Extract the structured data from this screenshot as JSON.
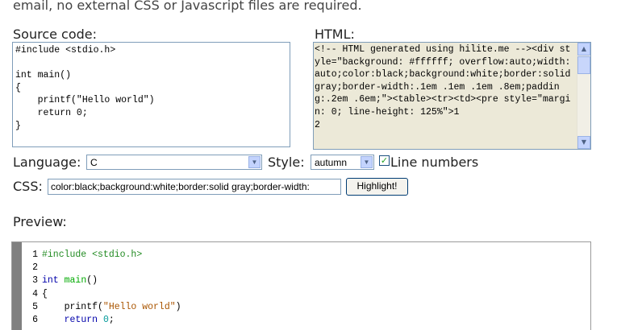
{
  "intro_text": "email, no external CSS or Javascript files are required.",
  "source": {
    "label": "Source code:",
    "code": "#include <stdio.h>\n\nint main()\n{\n    printf(\"Hello world\")\n    return 0;\n}"
  },
  "html_output": {
    "label": "HTML:",
    "text": "<!-- HTML generated using hilite.me --><div style=\"background: #ffffff; overflow:auto;width:auto;color:black;background:white;border:solid gray;border-width:.1em .1em .1em .8em;padding:.2em .6em;\"><table><tr><td><pre style=\"margin: 0; line-height: 125%\">1\n2"
  },
  "language": {
    "label": "Language:",
    "value": "C"
  },
  "style": {
    "label": "Style:",
    "value": "autumn"
  },
  "line_numbers": {
    "label": "Line numbers",
    "checked": true
  },
  "css": {
    "label": "CSS:",
    "value": "color:black;background:white;border:solid gray;border-width:"
  },
  "highlight_button": "Highlight!",
  "preview": {
    "label": "Preview:",
    "lines": [
      {
        "n": "1",
        "parts": [
          {
            "t": "#include <stdio.h>",
            "c": "pp"
          }
        ]
      },
      {
        "n": "2",
        "parts": []
      },
      {
        "n": "3",
        "parts": [
          {
            "t": "int",
            "c": "kw"
          },
          {
            "t": " "
          },
          {
            "t": "main",
            "c": "fn"
          },
          {
            "t": "()"
          }
        ]
      },
      {
        "n": "4",
        "parts": [
          {
            "t": "{"
          }
        ]
      },
      {
        "n": "5",
        "parts": [
          {
            "t": "    printf("
          },
          {
            "t": "\"Hello world\"",
            "c": "str"
          },
          {
            "t": ")"
          }
        ]
      },
      {
        "n": "6",
        "parts": [
          {
            "t": "    "
          },
          {
            "t": "return",
            "c": "kw"
          },
          {
            "t": " "
          },
          {
            "t": "0",
            "c": "num"
          },
          {
            "t": ";"
          }
        ]
      }
    ]
  },
  "icons": {
    "scroll_up": "arrow-up-icon",
    "scroll_down": "arrow-down-icon",
    "dropdown": "chevron-down-icon",
    "check": "checkmark-icon"
  },
  "colors": {
    "border": "#7f9db9",
    "scrollbar": "#c3d3fd",
    "readonly_bg": "#ece9d8",
    "preview_bar": "#808080",
    "preprocessor": "#228B22",
    "keyword": "#0000aa",
    "function": "#00aa00",
    "string": "#aa5500",
    "number": "#009999"
  }
}
